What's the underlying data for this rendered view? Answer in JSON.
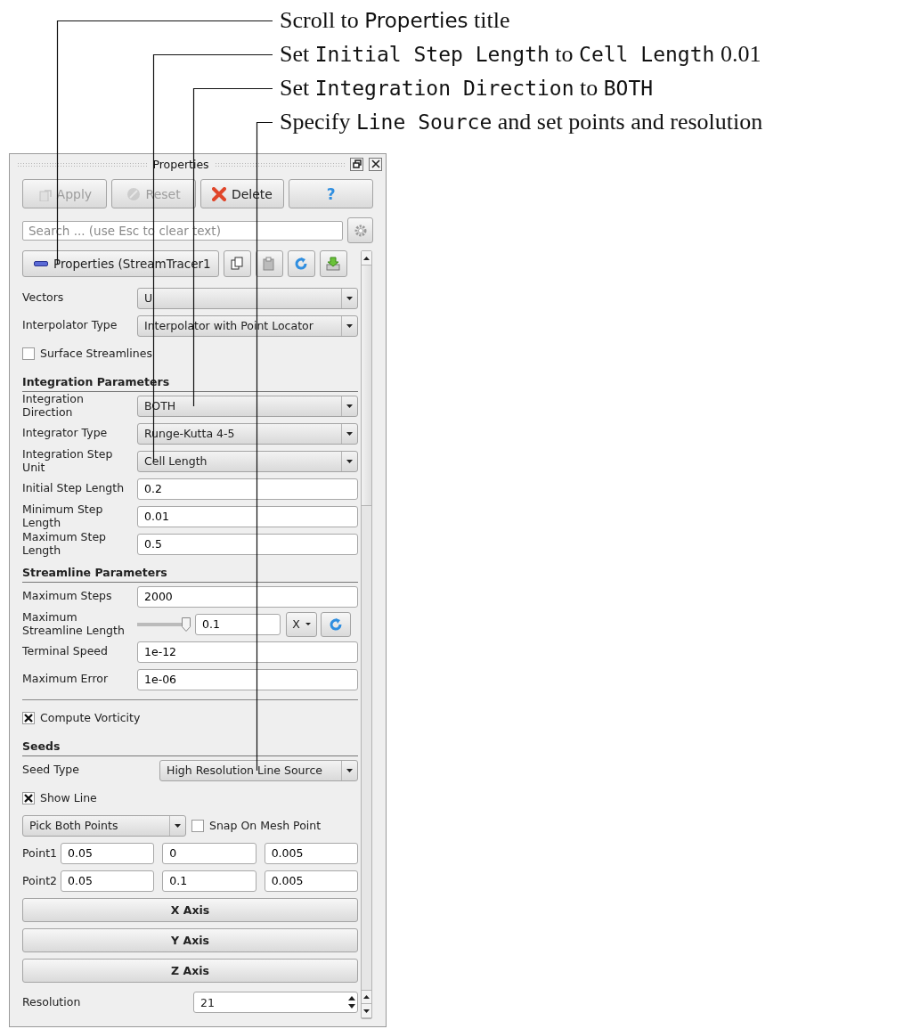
{
  "annotations": [
    {
      "parts": [
        {
          "kind": "plain",
          "text": "Scroll to "
        },
        {
          "kind": "ui",
          "text": "Properties"
        },
        {
          "kind": "plain",
          "text": " title"
        }
      ]
    },
    {
      "parts": [
        {
          "kind": "plain",
          "text": "Set "
        },
        {
          "kind": "code",
          "text": "Initial Step Length"
        },
        {
          "kind": "plain",
          "text": " to "
        },
        {
          "kind": "code",
          "text": "Cell Length"
        },
        {
          "kind": "plain",
          "text": " 0.01"
        }
      ]
    },
    {
      "parts": [
        {
          "kind": "plain",
          "text": "Set "
        },
        {
          "kind": "code",
          "text": "Integration Direction"
        },
        {
          "kind": "plain",
          "text": " to "
        },
        {
          "kind": "code",
          "text": "BOTH"
        }
      ]
    },
    {
      "parts": [
        {
          "kind": "plain",
          "text": "Specify "
        },
        {
          "kind": "code",
          "text": "Line Source"
        },
        {
          "kind": "plain",
          "text": " and set points and resolution"
        }
      ]
    }
  ],
  "panel": {
    "title": "Properties",
    "buttons": [
      {
        "kind": "apply",
        "label": "Apply",
        "disabled": true
      },
      {
        "kind": "reset",
        "label": "Reset",
        "disabled": true
      },
      {
        "kind": "delete",
        "label": "Delete",
        "disabled": false
      },
      {
        "kind": "help",
        "label": "?",
        "disabled": false
      }
    ],
    "search": {
      "placeholder": "Search ... (use Esc to clear text)"
    },
    "properties_button": {
      "label": "Properties (StreamTracer1"
    },
    "rows": [
      {
        "kind": "combo",
        "label": "Vectors",
        "value": "U"
      },
      {
        "kind": "combo",
        "label": "Interpolator Type",
        "value": "Interpolator with Point Locator"
      },
      {
        "kind": "checkbox",
        "label": "Surface Streamlines",
        "checked": false
      },
      {
        "kind": "header",
        "label": "Integration Parameters"
      },
      {
        "kind": "combo",
        "label": "Integration Direction",
        "value": "BOTH"
      },
      {
        "kind": "combo",
        "label": "Integrator Type",
        "value": "Runge-Kutta 4-5"
      },
      {
        "kind": "combo",
        "label": "Integration Step Unit",
        "value": "Cell Length"
      },
      {
        "kind": "input",
        "label": "Initial Step Length",
        "value": "0.2"
      },
      {
        "kind": "input",
        "label": "Minimum Step Length",
        "value": "0.01"
      },
      {
        "kind": "input",
        "label": "Maximum Step Length",
        "value": "0.5"
      },
      {
        "kind": "header",
        "label": "Streamline Parameters"
      },
      {
        "kind": "input",
        "label": "Maximum Steps",
        "value": "2000"
      },
      {
        "kind": "slider",
        "label": "Maximum Streamline Length",
        "level": 1,
        "value": "0.1",
        "unit": "X"
      },
      {
        "kind": "input",
        "label": "Terminal Speed",
        "value": "1e-12"
      },
      {
        "kind": "input",
        "label": "Maximum Error",
        "value": "1e-06"
      },
      {
        "kind": "separator"
      },
      {
        "kind": "checkbox",
        "label": "Compute Vorticity",
        "checked": true
      },
      {
        "kind": "header",
        "label": "Seeds"
      },
      {
        "kind": "combo_wide_label",
        "label": "Seed Type",
        "value": "High Resolution Line Source"
      },
      {
        "kind": "checkbox",
        "label": "Show Line",
        "checked": true
      },
      {
        "kind": "pick",
        "value": "Pick Both Points",
        "option": {
          "label": "Snap On Mesh Point",
          "checked": false
        }
      },
      {
        "kind": "point",
        "label": "Point1",
        "values": [
          "0.05",
          "0",
          "0.005"
        ]
      },
      {
        "kind": "point",
        "label": "Point2",
        "values": [
          "0.05",
          "0.1",
          "0.005"
        ]
      },
      {
        "kind": "button",
        "label": "X Axis"
      },
      {
        "kind": "button",
        "label": "Y Axis"
      },
      {
        "kind": "button",
        "label": "Z Axis"
      },
      {
        "kind": "spin",
        "label": "Resolution",
        "value": "21"
      }
    ]
  }
}
